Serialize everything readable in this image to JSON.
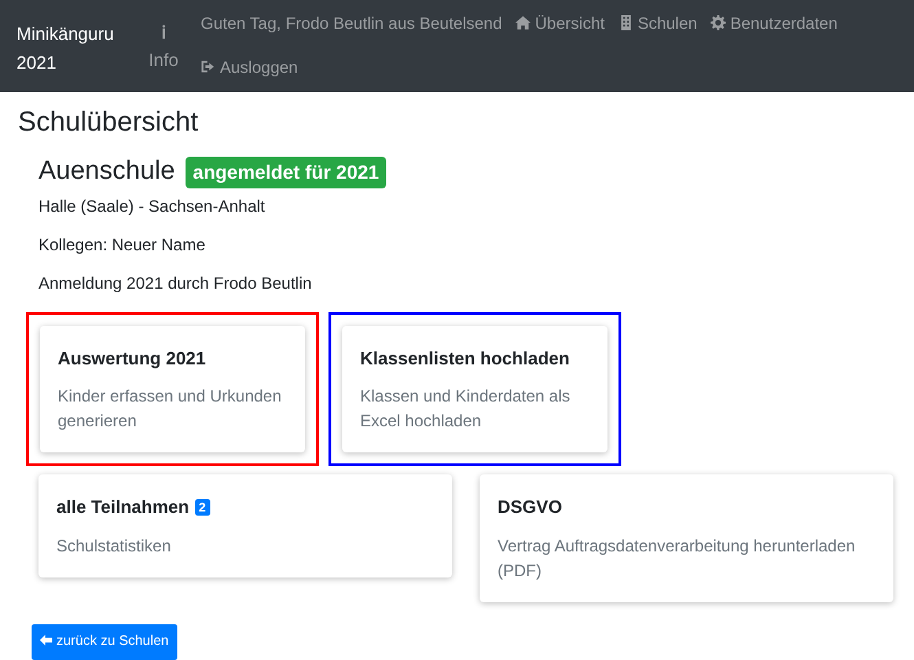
{
  "navbar": {
    "brand": [
      "Minikänguru",
      "2021"
    ],
    "info": {
      "icon": "ℹ",
      "label": "Info"
    },
    "greeting": "Guten Tag, Frodo Beutlin aus Beutelsend",
    "links": [
      {
        "kind": "home",
        "label": "Übersicht"
      },
      {
        "kind": "building",
        "label": "Schulen"
      },
      {
        "kind": "gear",
        "label": "Benutzerdaten"
      },
      {
        "kind": "logout",
        "label": "Ausloggen"
      }
    ]
  },
  "page_title": "Schulübersicht",
  "school": {
    "name": "Auenschule",
    "badge": "angemeldet für 2021",
    "location": "Halle (Saale) - Sachsen-Anhalt",
    "colleagues": "Kollegen: Neuer Name",
    "registration": "Anmeldung 2021 durch Frodo Beutlin"
  },
  "top_cards": [
    {
      "title": "Auswertung 2021",
      "text": "Kinder erfassen und Urkunden generieren",
      "color": "#ff0000"
    },
    {
      "title": "Klassenlisten hochladen",
      "text": "Klassen und Kinderdaten als Excel hochladen",
      "color": "#0000ff"
    }
  ],
  "bottom_cards": [
    {
      "title": "alle Teilnahmen",
      "count": "2",
      "text": "Schulstatistiken"
    },
    {
      "title": "DSGVO",
      "text": "Vertrag Auftragsdatenverarbeitung herunterladen (PDF)"
    }
  ],
  "back_button": {
    "label": "zurück zu Schulen"
  }
}
